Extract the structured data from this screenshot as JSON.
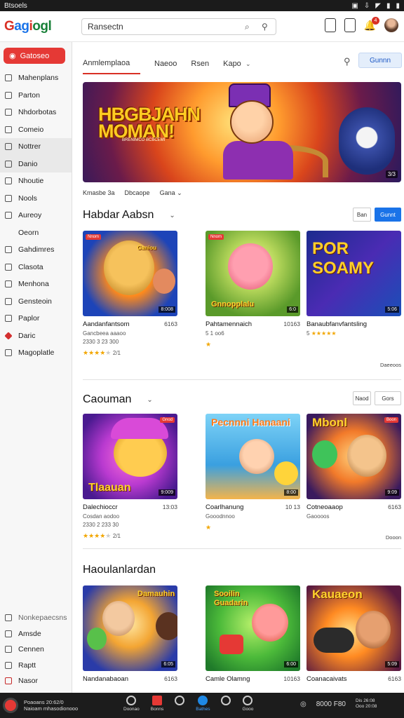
{
  "status_bar": {
    "left": "Btsoels",
    "right_icons": [
      "vibrate-icon",
      "download-icon",
      "wifi-icon",
      "signal-icon",
      "battery-icon"
    ]
  },
  "header": {
    "logo": "Gagiogl",
    "search_value": "Ransectn",
    "notification_count": "4"
  },
  "sidebar": {
    "primary": "Gatoseo",
    "items": [
      "Mahenplans",
      "Parton",
      "Nhdorbotas",
      "Comeio",
      "Nottrer",
      "Danio",
      "Nhoutie",
      "Nools",
      "Aureoy",
      "Oeorn",
      "Gahdimres",
      "Clasota",
      "Menhona",
      "Gensteoin",
      "Paplor",
      "Daric",
      "Magoplatle"
    ],
    "bottom_items": [
      "Nonkepaecsns",
      "Amsde",
      "Cennen",
      "Raptt",
      "Nasor"
    ]
  },
  "tabs": {
    "active": "Anmlemplaoa",
    "items": [
      "Naeoo",
      "Rsen",
      "Kapo"
    ]
  },
  "main_button": "Gunnn",
  "hero": {
    "title_line1": "HBGBJAHN",
    "title_line2": "MOMAN!",
    "subtitle": "BRENIMCO BCBCEMI",
    "counter": "3/3"
  },
  "hero_meta": [
    "Kmasbe 3a",
    "Dbcaope",
    "Gana"
  ],
  "sections": [
    {
      "title": "Habdar Aabsn",
      "buttons": [
        "Ban",
        "Gunnt"
      ],
      "more": "Daeeoos",
      "cards": [
        {
          "title": "Aandanfantsom",
          "num": "6163",
          "sub": "Gancbeea aaaoo",
          "sub2": "2330 3 23 300",
          "rating": "2/1",
          "tag": "Nnom",
          "dur": "8:008",
          "label": "Ganiou"
        },
        {
          "title": "Pahtamennaich",
          "num": "10163",
          "sub": "5 1 oo6",
          "sub2": "",
          "rating": "",
          "tag": "Nnom",
          "dur": "6:0",
          "label": "Gnnopplalu"
        },
        {
          "title": "Banaubfanvfantsling",
          "num": "8163",
          "sub": "5",
          "sub2": "",
          "rating": "",
          "tag": "",
          "dur": "5:06",
          "label": "POR SOAMY"
        }
      ]
    },
    {
      "title": "Caouman",
      "buttons": [
        "Naod",
        "Gors"
      ],
      "more": "Dooon",
      "cards": [
        {
          "title": "Dalechioccr",
          "num": "13:03",
          "sub": "Cosdan aodoo",
          "sub2": "2330 2 233 30",
          "rating": "2/1",
          "tag": "Gnod",
          "dur": "9:009",
          "label": "Tlaauan"
        },
        {
          "title": "Coarlhanung",
          "num": "10 13",
          "sub": "Gooodnnoo",
          "sub2": "",
          "rating": "",
          "tag": "Nnon",
          "dur": "8:00",
          "label": "Pecnnni Hanaani"
        },
        {
          "title": "Cotneoaaop",
          "num": "6163",
          "sub": "Gaoooos",
          "sub2": "",
          "rating": "",
          "tag": "Boon",
          "dur": "9:09",
          "label": "Mbonl"
        }
      ]
    },
    {
      "title": "Haoulanlardan",
      "buttons": [],
      "more": "",
      "cards": [
        {
          "title": "Nandanabaoan",
          "num": "6163",
          "sub": "",
          "sub2": "",
          "rating": "",
          "tag": "",
          "dur": "6:05",
          "label": "Damauhin"
        },
        {
          "title": "Camle Olamng",
          "num": "10163",
          "sub": "",
          "sub2": "",
          "rating": "",
          "tag": "",
          "dur": "6:00",
          "label": "Sooilin Guadarin"
        },
        {
          "title": "Coanacaivats",
          "num": "6163",
          "sub": "",
          "sub2": "",
          "rating": "",
          "tag": "",
          "dur": "5:09",
          "label": "Kauaeon"
        }
      ]
    }
  ],
  "bottom_bar": {
    "text1": "Poaoans 20:62/0",
    "text2": "Naioam mhasodionooo",
    "icons": [
      "Doonao",
      "Bonns",
      "",
      "Bathes",
      "",
      "Gooo"
    ],
    "time": "8000 F80",
    "right1": "Dis 26:08",
    "right2": "Ooo 20:08"
  }
}
